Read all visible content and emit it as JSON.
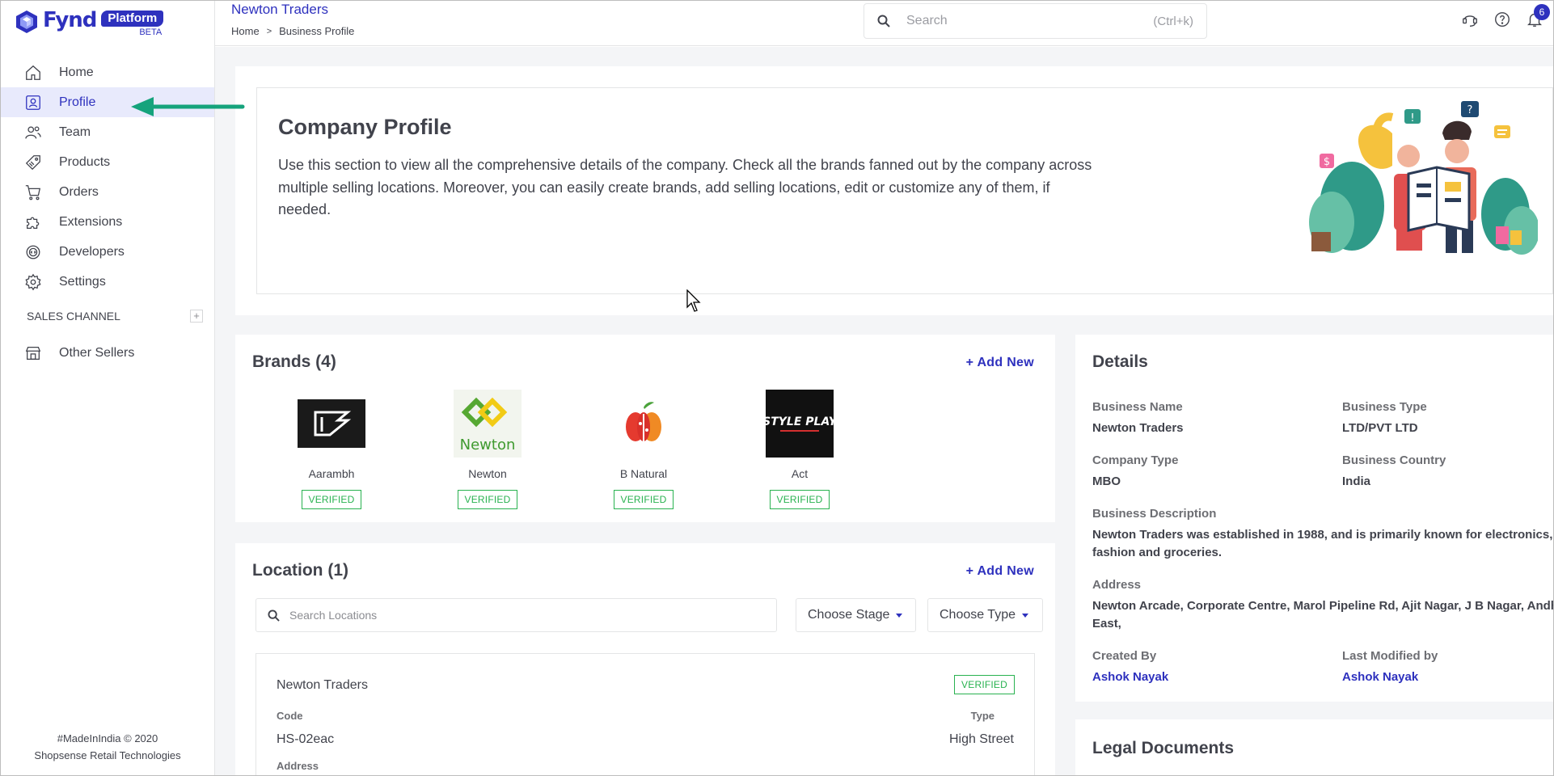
{
  "brand": {
    "logo_text": "Fynd",
    "platform_label": "Platform",
    "beta_label": "BETA"
  },
  "sidebar": {
    "items": [
      {
        "label": "Home",
        "icon": "home-icon"
      },
      {
        "label": "Profile",
        "icon": "profile-icon"
      },
      {
        "label": "Team",
        "icon": "team-icon"
      },
      {
        "label": "Products",
        "icon": "tag-icon"
      },
      {
        "label": "Orders",
        "icon": "cart-icon"
      },
      {
        "label": "Extensions",
        "icon": "puzzle-icon"
      },
      {
        "label": "Developers",
        "icon": "developer-gear-icon"
      },
      {
        "label": "Settings",
        "icon": "gear-icon"
      }
    ],
    "sales_channel_label": "SALES CHANNEL",
    "other_sellers_label": "Other Sellers",
    "footer_line1": "#MadeInIndia © 2020",
    "footer_line2": "Shopsense Retail Technologies"
  },
  "header": {
    "company_name": "Newton Traders",
    "breadcrumb_home": "Home",
    "breadcrumb_current": "Business Profile",
    "search_placeholder": "Search",
    "search_shortcut": "(Ctrl+k)",
    "notification_count": "6"
  },
  "hero": {
    "title": "Company Profile",
    "description": "Use this section to view all the comprehensive details of the company. Check all the brands fanned out by the company across multiple selling locations. Moreover, you can easily create brands, add selling locations, edit or customize any of them, if needed."
  },
  "brands": {
    "title": "Brands (4)",
    "add_new": "+ Add New",
    "items": [
      {
        "name": "Aarambh",
        "status": "VERIFIED"
      },
      {
        "name": "Newton",
        "status": "VERIFIED",
        "logo_text": "Newton"
      },
      {
        "name": "B Natural",
        "status": "VERIFIED"
      },
      {
        "name": "Act",
        "status": "VERIFIED",
        "logo_text": "STYLE PLAY"
      }
    ]
  },
  "location": {
    "title": "Location (1)",
    "add_new": "+ Add New",
    "search_placeholder": "Search Locations",
    "stage_dropdown": "Choose Stage",
    "type_dropdown": "Choose Type",
    "card": {
      "name": "Newton Traders",
      "status": "VERIFIED",
      "code_label": "Code",
      "code_value": "HS-02eac",
      "type_label": "Type",
      "type_value": "High Street",
      "address_label": "Address"
    }
  },
  "details": {
    "title": "Details",
    "business_name_label": "Business Name",
    "business_name": "Newton Traders",
    "business_type_label": "Business Type",
    "business_type": "LTD/PVT LTD",
    "company_type_label": "Company Type",
    "company_type": "MBO",
    "business_country_label": "Business Country",
    "business_country": "India",
    "description_label": "Business Description",
    "description_line1": "Newton Traders was established in 1988, and is primarily known for electronics,",
    "description_line2": "fashion and groceries.",
    "address_label": "Address",
    "address_line1": "Newton Arcade, Corporate Centre, Marol Pipeline Rd, Ajit Nagar, J B Nagar, Andheri",
    "address_line2": "East,",
    "created_by_label": "Created By",
    "created_by": "Ashok Nayak",
    "modified_by_label": "Last Modified by",
    "modified_by": "Ashok Nayak"
  },
  "legal": {
    "title": "Legal Documents"
  },
  "colors": {
    "primary": "#2e31be",
    "verified": "#29b250",
    "annotation_arrow": "#15a37c",
    "active_bg": "#e8eafc"
  }
}
